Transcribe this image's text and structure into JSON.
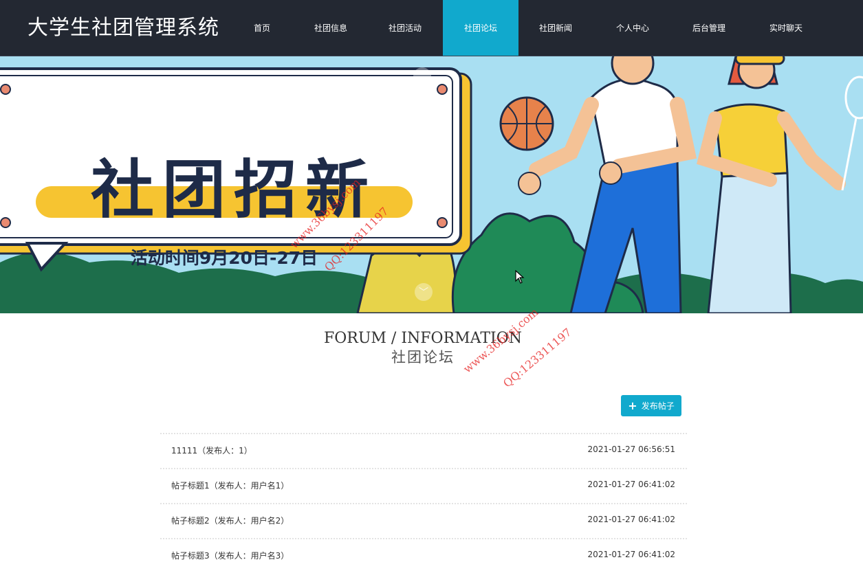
{
  "header": {
    "brand": "大学生社团管理系统",
    "nav": [
      "首页",
      "社团信息",
      "社团活动",
      "社团论坛",
      "社团新闻",
      "个人中心",
      "后台管理",
      "实时聊天"
    ],
    "active_index": 3
  },
  "banner": {
    "title": "社团招新",
    "subtitle": "活动时间9月20日-27日"
  },
  "section": {
    "title": "FORUM / INFORMATION",
    "subtitle": "社团论坛"
  },
  "actions": {
    "post_button": "发布帖子"
  },
  "posts": [
    {
      "title": "11111（发布人：1）",
      "time": "2021-01-27 06:56:51"
    },
    {
      "title": "帖子标题1（发布人：用户名1）",
      "time": "2021-01-27 06:41:02"
    },
    {
      "title": "帖子标题2（发布人：用户名2）",
      "time": "2021-01-27 06:41:02"
    },
    {
      "title": "帖子标题3（发布人：用户名3）",
      "time": "2021-01-27 06:41:02"
    }
  ],
  "watermarks": [
    {
      "site": "www.36bysj.com",
      "qq": "QQ:123311197"
    },
    {
      "site": "www.36bysj.com",
      "qq": "QQ:123311197"
    }
  ],
  "colors": {
    "header_bg": "#232832",
    "accent": "#11a9cd",
    "banner_sky": "#a9dff2"
  }
}
